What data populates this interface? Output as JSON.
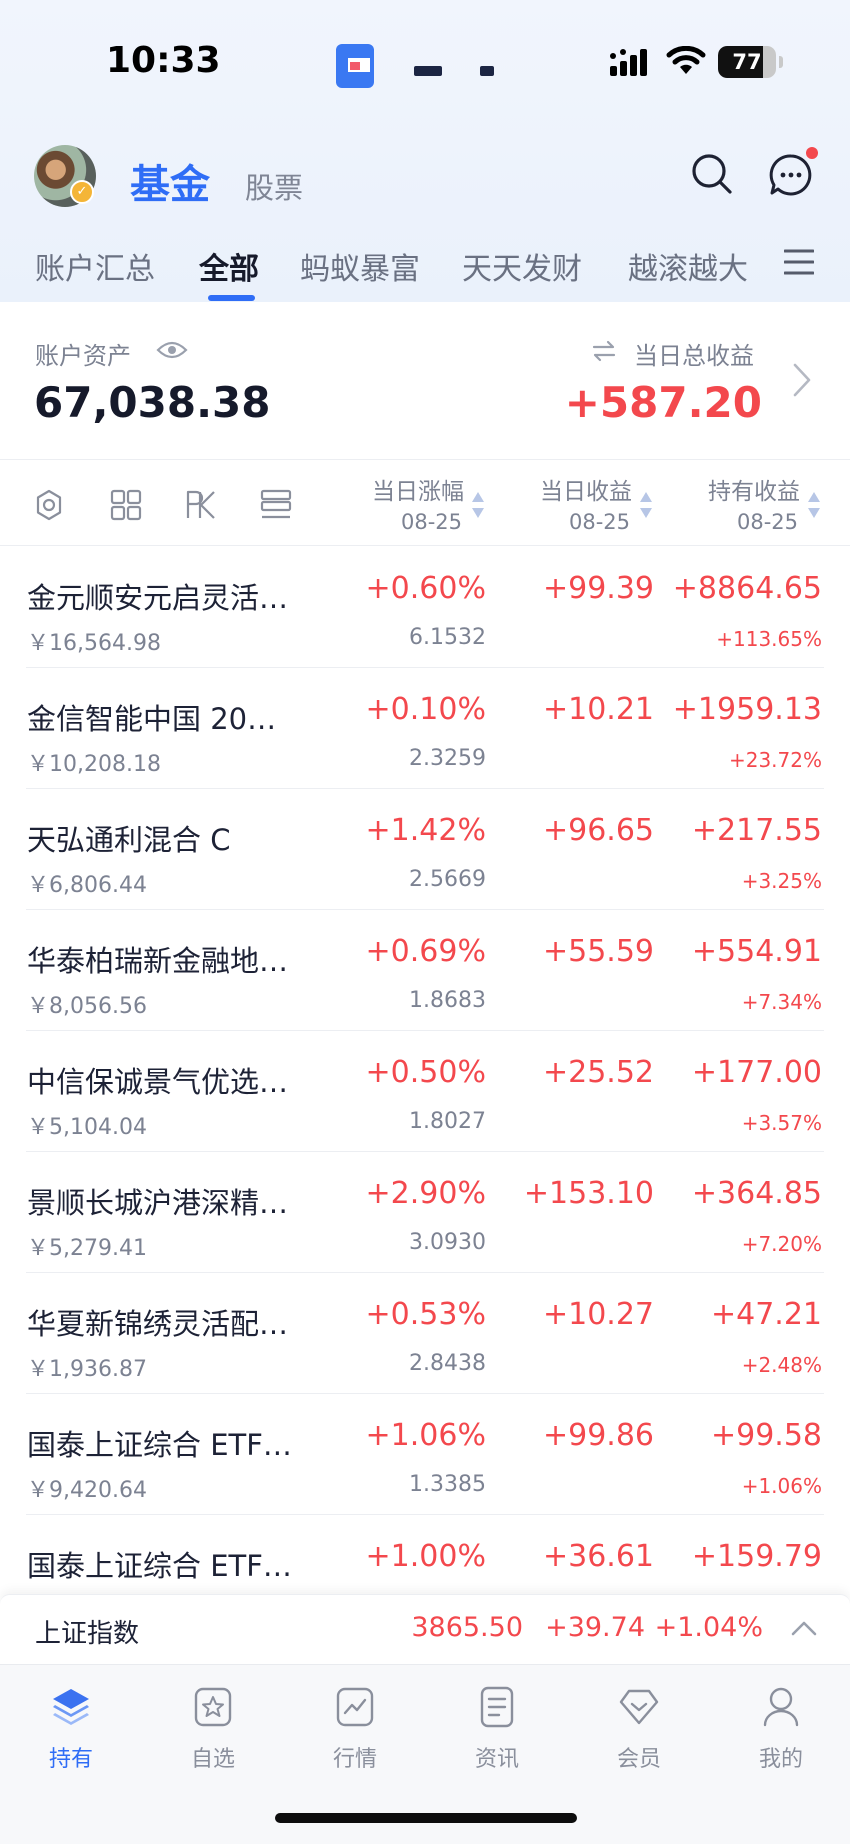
{
  "status_bar": {
    "time": "10:33",
    "battery": "77",
    "battery_level": 0.77
  },
  "header": {
    "title": "基金",
    "subtitle": "股票"
  },
  "tabs": [
    {
      "label": "账户汇总"
    },
    {
      "label": "全部"
    },
    {
      "label": "蚂蚁暴富"
    },
    {
      "label": "天天发财"
    },
    {
      "label": "越滚越大"
    }
  ],
  "summary": {
    "assets_label": "账户资产",
    "assets_value": "67,038.38",
    "daily_label": "当日总收益",
    "daily_value": "+587.20"
  },
  "columns": [
    {
      "title": "当日涨幅",
      "date": "08-25"
    },
    {
      "title": "当日收益",
      "date": "08-25"
    },
    {
      "title": "持有收益",
      "date": "08-25"
    }
  ],
  "funds": [
    {
      "name": "金元顺安元启灵活…",
      "amount": "￥16,564.98",
      "pct": "+0.60%",
      "nav": "6.1532",
      "daily": "+99.39",
      "hold": "+8864.65",
      "hold_pct": "+113.65%"
    },
    {
      "name": "金信智能中国 20…",
      "amount": "￥10,208.18",
      "pct": "+0.10%",
      "nav": "2.3259",
      "daily": "+10.21",
      "hold": "+1959.13",
      "hold_pct": "+23.72%"
    },
    {
      "name": "天弘通利混合 C",
      "amount": "￥6,806.44",
      "pct": "+1.42%",
      "nav": "2.5669",
      "daily": "+96.65",
      "hold": "+217.55",
      "hold_pct": "+3.25%"
    },
    {
      "name": "华泰柏瑞新金融地…",
      "amount": "￥8,056.56",
      "pct": "+0.69%",
      "nav": "1.8683",
      "daily": "+55.59",
      "hold": "+554.91",
      "hold_pct": "+7.34%"
    },
    {
      "name": "中信保诚景气优选…",
      "amount": "￥5,104.04",
      "pct": "+0.50%",
      "nav": "1.8027",
      "daily": "+25.52",
      "hold": "+177.00",
      "hold_pct": "+3.57%"
    },
    {
      "name": "景顺长城沪港深精…",
      "amount": "￥5,279.41",
      "pct": "+2.90%",
      "nav": "3.0930",
      "daily": "+153.10",
      "hold": "+364.85",
      "hold_pct": "+7.20%"
    },
    {
      "name": "华夏新锦绣灵活配…",
      "amount": "￥1,936.87",
      "pct": "+0.53%",
      "nav": "2.8438",
      "daily": "+10.27",
      "hold": "+47.21",
      "hold_pct": "+2.48%"
    },
    {
      "name": "国泰上证综合 ETF…",
      "amount": "￥9,420.64",
      "pct": "+1.06%",
      "nav": "1.3385",
      "daily": "+99.86",
      "hold": "+99.58",
      "hold_pct": "+1.06%"
    },
    {
      "name": "国泰上证综合 ETF…",
      "amount": "",
      "pct": "+1.00%",
      "nav": "",
      "daily": "+36.61",
      "hold": "+159.79",
      "hold_pct": ""
    }
  ],
  "index_bar": {
    "name": "上证指数",
    "value": "3865.50",
    "change": "+39.74",
    "pct": "+1.04%"
  },
  "bottom_nav": [
    {
      "label": "持有",
      "icon": "layers-icon"
    },
    {
      "label": "自选",
      "icon": "star-icon"
    },
    {
      "label": "行情",
      "icon": "chart-icon"
    },
    {
      "label": "资讯",
      "icon": "news-icon"
    },
    {
      "label": "会员",
      "icon": "diamond-icon"
    },
    {
      "label": "我的",
      "icon": "user-icon"
    }
  ],
  "colors": {
    "accent": "#2f6df6",
    "up": "#f3484d",
    "text": "#1d2236",
    "muted": "#7c8292"
  }
}
